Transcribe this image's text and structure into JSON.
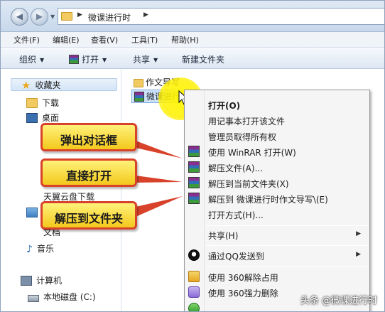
{
  "addressbar": {
    "path": "微课进行时"
  },
  "menubar": {
    "items": [
      "文件(F)",
      "编辑(E)",
      "查看(V)",
      "工具(T)",
      "帮助(H)"
    ]
  },
  "toolbar": {
    "organize": "组织",
    "open": "打开",
    "share": "共享",
    "new_folder": "新建文件夹"
  },
  "sidebar": {
    "favorites": "收藏夹",
    "downloads": "下载",
    "desktop": "桌面",
    "frag_tianyi": "天翼云盘下载",
    "frag_doc": "文档",
    "music": "音乐",
    "computer": "计算机",
    "local_disk": "本地磁盘 (C:)"
  },
  "files": {
    "folder_name": "作文导写",
    "selected_name": "微课进行时作文导写"
  },
  "context_menu": {
    "items": [
      {
        "label": "打开(O)",
        "bold": true
      },
      {
        "label": "用记事本打开该文件"
      },
      {
        "label": "管理员取得所有权"
      },
      {
        "label": "使用 WinRAR 打开(W)",
        "icon": "winrar-icon"
      },
      {
        "label": "解压文件(A)...",
        "icon": "winrar-icon"
      },
      {
        "label": "解压到当前文件夹(X)",
        "icon": "winrar-icon"
      },
      {
        "label": "解压到 微课进行时作文导写\\(E)",
        "icon": "winrar-icon"
      },
      {
        "label": "打开方式(H)..."
      },
      {
        "label": "共享(H)",
        "submenu": true
      },
      {
        "label": "通过QQ发送到",
        "submenu": true,
        "icon": "qq-icon"
      },
      {
        "label": "使用 360解除占用",
        "icon": "360-unlock-icon"
      },
      {
        "label": "使用 360强力删除",
        "icon": "360-delete-icon"
      }
    ],
    "submenu_arrow": "▶"
  },
  "callouts": {
    "dialog": "弹出对话框",
    "open_direct": "直接打开",
    "extract_folder": "解压到文件夹"
  },
  "watermark": "头条 @微课进行时",
  "colors": {
    "callout_border": "#d9422a",
    "callout_fill": "#f3c81c",
    "highlight": "#fff600",
    "selection": "#cde3fa"
  }
}
